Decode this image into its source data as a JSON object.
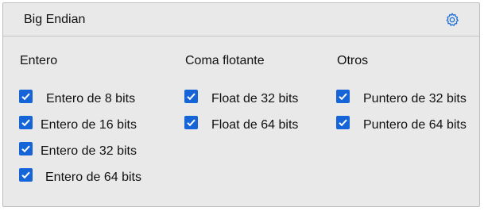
{
  "header": {
    "title": "Big Endian",
    "settings_icon": "gear-icon"
  },
  "columns": [
    {
      "title": "Entero",
      "items": [
        {
          "label": "Entero de 8 bits",
          "checked": true
        },
        {
          "label": "Entero de 16 bits",
          "checked": true
        },
        {
          "label": "Entero de 32 bits",
          "checked": true
        },
        {
          "label": "Entero de 64 bits",
          "checked": true
        }
      ]
    },
    {
      "title": "Coma flotante",
      "items": [
        {
          "label": "Float de 32 bits",
          "checked": true
        },
        {
          "label": "Float de 64 bits",
          "checked": true
        }
      ]
    },
    {
      "title": "Otros",
      "items": [
        {
          "label": "Puntero de 32 bits",
          "checked": true
        },
        {
          "label": "Puntero de 64 bits",
          "checked": true
        }
      ]
    }
  ],
  "colors": {
    "checkbox": "#1565d8",
    "gear": "#1f6fd6",
    "panel_bg": "#e9e9e9"
  }
}
